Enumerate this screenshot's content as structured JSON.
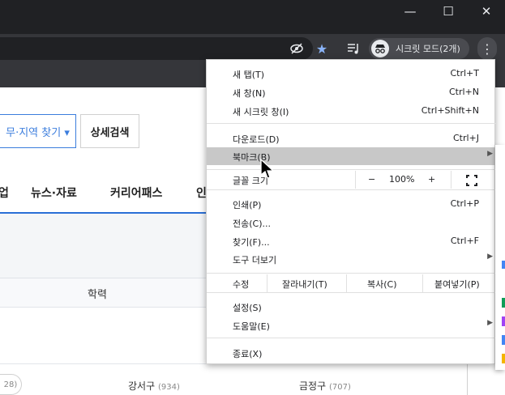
{
  "window": {
    "minimize_icon": "minimize-icon",
    "maximize_icon": "maximize-icon",
    "close_icon": "close-icon"
  },
  "toolbar": {
    "incognito_label": "시크릿 모드(2개)",
    "icons": [
      "eye-off-icon",
      "star-icon",
      "media-queue-icon",
      "incognito-icon",
      "kebab-menu-icon"
    ],
    "star_color": "#8ab4f8"
  },
  "page": {
    "filter_button": "무·지역 찾기 ▾",
    "detail_button": "상세검색",
    "nav_tabs": [
      "업",
      "뉴스·자료",
      "커리어패스",
      "인"
    ],
    "table_header": "학력",
    "chip": "28)",
    "districts": [
      {
        "name": "강서구",
        "count": "(934)"
      },
      {
        "name": "금정구",
        "count": "(707)"
      }
    ],
    "accent_color": "#2a6fd6"
  },
  "menu": {
    "items": [
      {
        "label": "새 탭(T)",
        "shortcut": "Ctrl+T"
      },
      {
        "label": "새 창(N)",
        "shortcut": "Ctrl+N"
      },
      {
        "label": "새 시크릿 창(I)",
        "shortcut": "Ctrl+Shift+N"
      },
      {
        "label": "다운로드(D)",
        "shortcut": "Ctrl+J"
      },
      {
        "label": "북마크(B)",
        "shortcut": ""
      },
      {
        "label": "글꼴 크기",
        "shortcut": ""
      },
      {
        "label": "인쇄(P)",
        "shortcut": "Ctrl+P"
      },
      {
        "label": "전송(C)...",
        "shortcut": ""
      },
      {
        "label": "찾기(F)...",
        "shortcut": "Ctrl+F"
      },
      {
        "label": "도구 더보기",
        "shortcut": ""
      },
      {
        "label": "설정(S)",
        "shortcut": ""
      },
      {
        "label": "도움말(E)",
        "shortcut": ""
      },
      {
        "label": "종료(X)",
        "shortcut": ""
      }
    ],
    "zoom": {
      "minus": "−",
      "value": "100%",
      "plus": "+"
    },
    "edit": {
      "label": "수정",
      "cut": "잘라내기(T)",
      "copy": "복사(C)",
      "paste": "붙여넣기(P)"
    },
    "highlight_color": "#c8c8c8"
  },
  "submenu_marks": [
    "#4285f4",
    "#0f9d58",
    "#a142f4",
    "#4285f4",
    "#f4b400"
  ]
}
